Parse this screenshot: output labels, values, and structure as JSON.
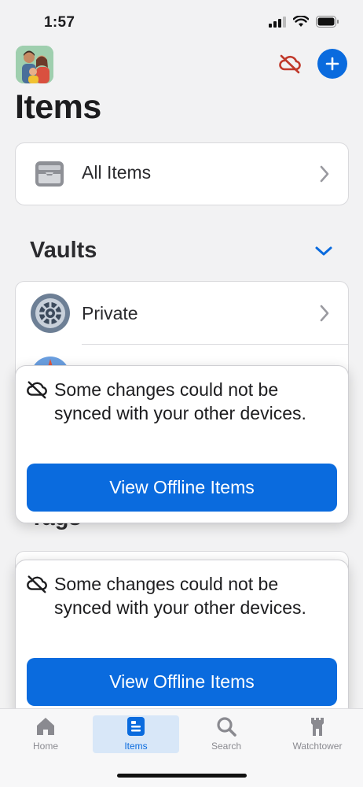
{
  "status_bar": {
    "time": "1:57"
  },
  "header": {
    "title": "Items"
  },
  "all_items": {
    "label": "All Items"
  },
  "vaults": {
    "title": "Vaults",
    "items": [
      {
        "label": "Private"
      }
    ]
  },
  "tags": {
    "title": "Tags"
  },
  "toast": {
    "message": "Some changes could not be synced with your other devices.",
    "button": "View Offline Items"
  },
  "tabbar": {
    "tabs": [
      {
        "label": "Home",
        "icon": "home-icon"
      },
      {
        "label": "Items",
        "icon": "items-icon",
        "active": true
      },
      {
        "label": "Search",
        "icon": "search-icon"
      },
      {
        "label": "Watchtower",
        "icon": "watchtower-icon"
      }
    ]
  },
  "colors": {
    "accent": "#0a6bde",
    "sync_off": "#c0392b",
    "background": "#f2f2f3"
  }
}
